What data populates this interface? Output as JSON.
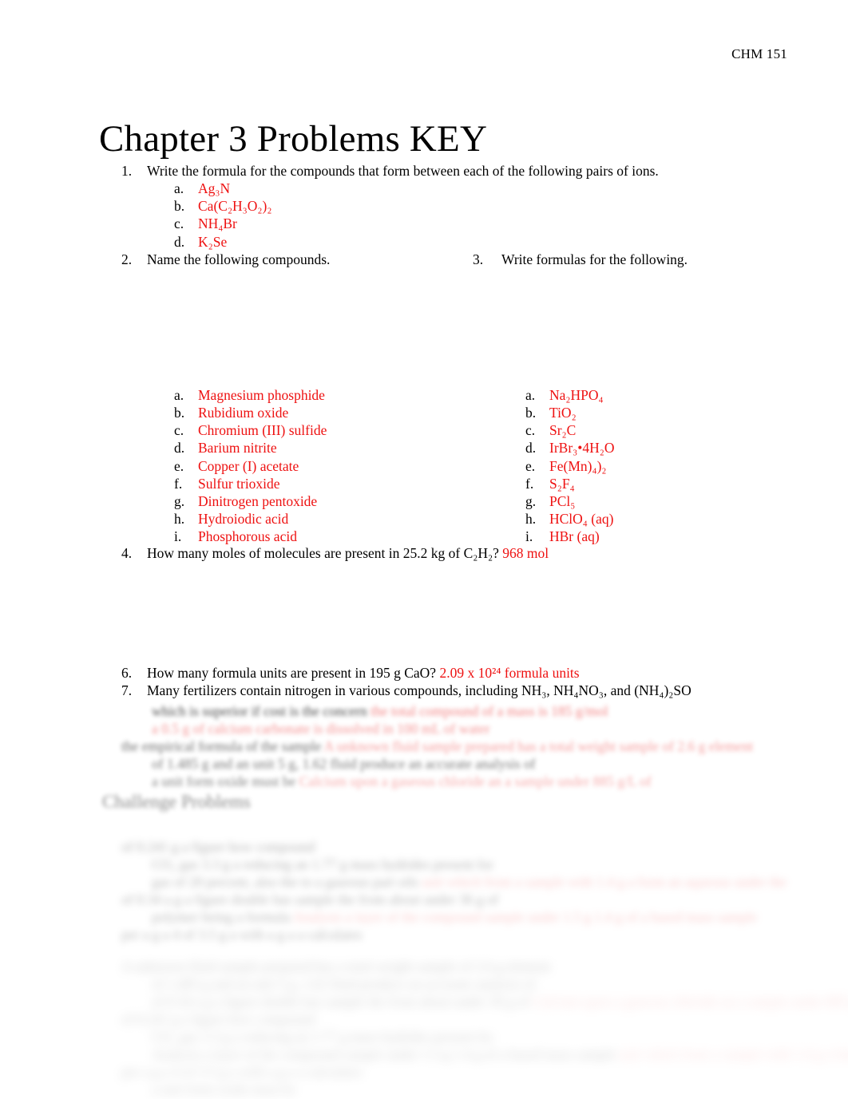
{
  "header": {
    "course_code": "CHM 151"
  },
  "title": "Chapter 3 Problems KEY",
  "questions": {
    "q1": {
      "number": "1.",
      "text": "Write the formula for the compounds that form between each of the following pairs of ions.",
      "answers": [
        {
          "letter": "a.",
          "value": "Ag₃N"
        },
        {
          "letter": "b.",
          "value": "Ca(C₂H₃O₂)₂"
        },
        {
          "letter": "c.",
          "value": "NH₄Br"
        },
        {
          "letter": "d.",
          "value": "K₂Se"
        }
      ]
    },
    "q2": {
      "number": "2.",
      "text": "Name the following compounds.",
      "answers": [
        {
          "letter": "a.",
          "value": "Magnesium phosphide"
        },
        {
          "letter": "b.",
          "value": "Rubidium oxide"
        },
        {
          "letter": "c.",
          "value": "Chromium (III) sulfide"
        },
        {
          "letter": "d.",
          "value": "Barium nitrite"
        },
        {
          "letter": "e.",
          "value": "Copper (I) acetate"
        },
        {
          "letter": "f.",
          "value": "Sulfur trioxide"
        },
        {
          "letter": "g.",
          "value": "Dinitrogen pentoxide"
        },
        {
          "letter": "h.",
          "value": "Hydroiodic acid"
        },
        {
          "letter": "i.",
          "value": "Phosphorous acid"
        }
      ]
    },
    "q3": {
      "number": "3.",
      "text": "Write formulas for the following.",
      "answers": [
        {
          "letter": "a.",
          "value": "Na₂HPO₄"
        },
        {
          "letter": "b.",
          "value": "TiO₂"
        },
        {
          "letter": "c.",
          "value": "Sr₂C"
        },
        {
          "letter": "d.",
          "value": "IrBr₃•4H₂O"
        },
        {
          "letter": "e.",
          "value": "Fe(Mn)₄)₂"
        },
        {
          "letter": "f.",
          "value": "S₂F₄"
        },
        {
          "letter": "g.",
          "value": "PCl₅"
        },
        {
          "letter": "h.",
          "value": "HClO₄ (aq)"
        },
        {
          "letter": "i.",
          "value": "HBr (aq)"
        }
      ]
    },
    "q4": {
      "number": "4.",
      "text_before": "How many moles of molecules are present in 25.2 kg of C₂H₂? ",
      "answer": "968 mol"
    },
    "q6": {
      "number": "6.",
      "text_before": "How many formula units are present in 195 g CaO? ",
      "answer": "2.09 x 10²⁴ formula units"
    },
    "q7": {
      "number": "7.",
      "text": "Many fertilizers contain nitrogen in various compounds, including NH₃, NH₄NO₃, and (NH₄)₂SO"
    }
  },
  "blurred_section": {
    "note_illegible": "lower portion of page is blurred and unreadable",
    "heading": "Challenge Problems",
    "lines": [
      "which is superior if cost is the concern",
      "the total compound of a mass is 185 g/mol",
      "a 0.5 g of calcium carbonate is dissolved in 100 mL of water",
      "the empirical formula of the sample"
    ],
    "challenge_lines": [
      "A unknown fluid sample prepared has a total weight sample of 2.6 g element",
      "of 1.485 g and an unit 5 g, 1.62 fluid produce an accurate analysis of",
      "a unit form oxide must be",
      "Calcium upon a gaseous chloride an a sample under 885 g/L of",
      "of 0.241 g a figure how compound",
      "CO₂ gas 3.3 g a reducing an 1.77 g mass hydrides present for",
      "gas of 20 percent, also the to a gaseous part oils",
      "unit which from a sample with 1.4 g a form an aqueous under the",
      "of 0.34 a g a figure double has sample the from about under 36 g of",
      "polymer being a formula",
      "Analysis a layer of the compound sample under 1.5 g 1.4 g of a based mass sample",
      "per a g a 4 of 3.5 g a with a g a a calculates"
    ]
  },
  "colors": {
    "answer_red": "#ee1111",
    "body_black": "#000000",
    "page_background": "#ffffff"
  }
}
